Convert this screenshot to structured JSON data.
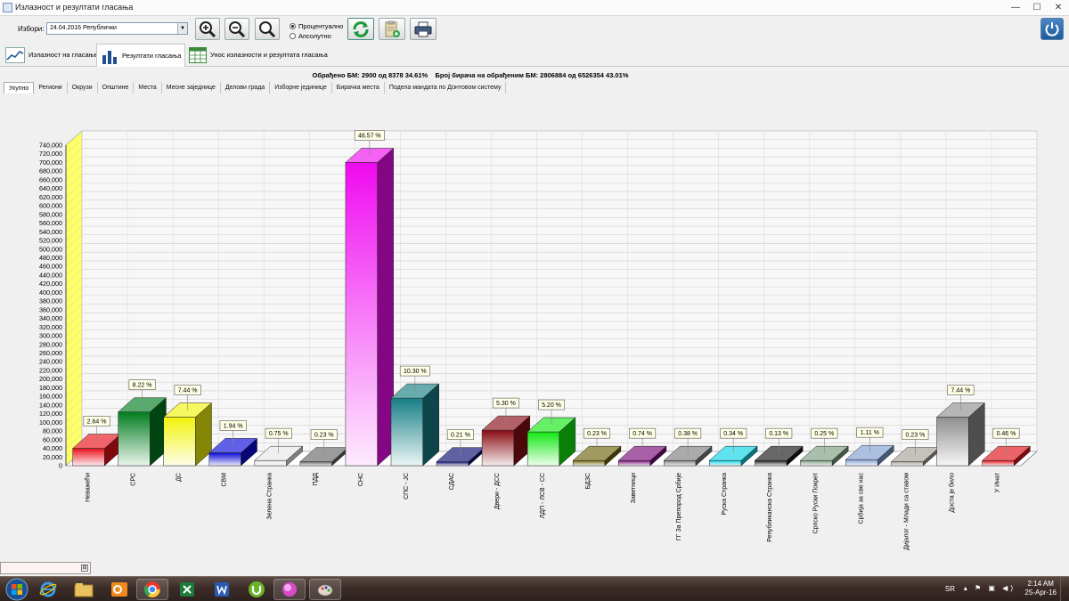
{
  "window": {
    "title": "Излазност и резултати гласања",
    "controls": {
      "minimize": "—",
      "maximize": "☐",
      "close": "✕"
    }
  },
  "toolbar": {
    "election_label": "Избори:",
    "election_value": "24.04.2016 Републички",
    "radio_percent": "Процентуално",
    "radio_absolute": "Апсолутно",
    "mode_selected": "percent"
  },
  "view_tabs": [
    {
      "label": "Излазност на гласање",
      "active": false
    },
    {
      "label": "Резултати гласања",
      "active": true
    },
    {
      "label": "Унос излазности и резултата гласања",
      "active": false
    }
  ],
  "status": {
    "processed": "Обрађено БМ: 2900 од 8378  34.61%",
    "voters": "Број бирача на обрађеним БМ: 2806884 од 6526354  43.01%"
  },
  "sub_tabs": [
    {
      "label": "Укупно",
      "active": true
    },
    {
      "label": "Региони",
      "active": false
    },
    {
      "label": "Окрузи",
      "active": false
    },
    {
      "label": "Општине",
      "active": false
    },
    {
      "label": "Места",
      "active": false
    },
    {
      "label": "Месне заједнице",
      "active": false
    },
    {
      "label": "Делови града",
      "active": false
    },
    {
      "label": "Изборне јединице",
      "active": false
    },
    {
      "label": "Бирачка места",
      "active": false
    },
    {
      "label": "Подела мандата по Донтовом систему",
      "active": false
    }
  ],
  "chart_data": {
    "type": "bar",
    "ylim": [
      0,
      740000
    ],
    "ytick_step": 20000,
    "grid": true,
    "categories": [
      "Неважећи",
      "СРС",
      "ДС",
      "СВМ",
      "Зелена Странка",
      "ПДД",
      "СНС",
      "СПС - ЈС",
      "СДАС",
      "Двери - ДСС",
      "ЛДП - ЛСВ - СС",
      "БДЗС",
      "Заветници",
      "ГГ За Препород Србије",
      "Руска Странка",
      "Републиканска Странка",
      "Српско Руски Покрет",
      "Србија за све нас",
      "Дијалог - Млади са ставом",
      "Доста је било",
      "У Инат"
    ],
    "values": [
      40000,
      124000,
      112000,
      30000,
      12000,
      9000,
      700000,
      156000,
      9000,
      82000,
      78000,
      12000,
      12000,
      12000,
      12000,
      12000,
      12000,
      14000,
      9000,
      112000,
      12000
    ],
    "labels": [
      "2.64 %",
      "8.22 %",
      "7.44 %",
      "1.94 %",
      "0.75 %",
      "0.23 %",
      "46.57 %",
      "10.30 %",
      "0.21 %",
      "5.30 %",
      "5.20 %",
      "0.23 %",
      "0.74 %",
      "0.38 %",
      "0.34 %",
      "0.13 %",
      "0.25 %",
      "1.11 %",
      "0.23 %",
      "7.44 %",
      "0.46 %"
    ],
    "colors": [
      "#e8101a",
      "#007d1e",
      "#f2f20a",
      "#0a0ad8",
      "#e6e6e6",
      "#666666",
      "#f00af0",
      "#177f86",
      "#0a0a73",
      "#8a0c14",
      "#12e812",
      "#6e640a",
      "#7a0a7a",
      "#7c7c7c",
      "#0ad2e6",
      "#151515",
      "#7a9d80",
      "#7f9ed2",
      "#a6a096",
      "#8e8e8e",
      "#e0101a"
    ]
  },
  "statuspanel": {
    "button": "⊟"
  },
  "taskbar": {
    "language": "SR",
    "tray_icons": "▴ ⚑ ▣ ◀)",
    "time": "2:14 AM",
    "date": "25-Apr-16"
  }
}
